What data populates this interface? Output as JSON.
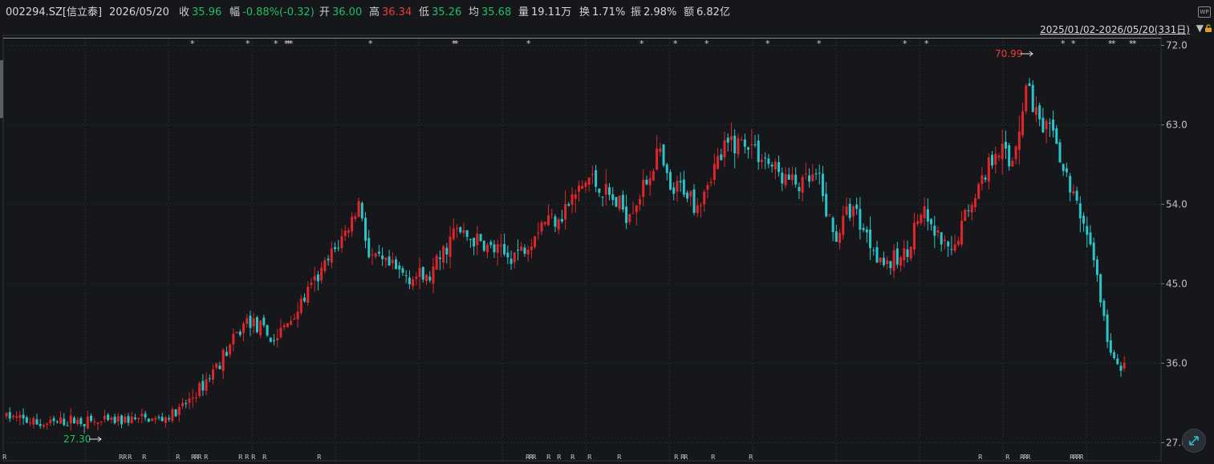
{
  "header": {
    "code": "002294.SZ[信立泰]",
    "date": "2026/05/20",
    "close_label": "收",
    "close": "35.96",
    "change_label": "幅",
    "change": "-0.88%(-0.32)",
    "open_label": "开",
    "open": "36.00",
    "high_label": "高",
    "high": "36.34",
    "low_label": "低",
    "low": "35.26",
    "avg_label": "均",
    "avg": "35.68",
    "volume_label": "量",
    "volume": "19.11万",
    "turnover_label": "换",
    "turnover": "1.71%",
    "amplitude_label": "振",
    "amplitude": "2.98%",
    "amount_label": "额",
    "amount": "6.82亿"
  },
  "range_label": "2025/01/02-2026/05/20(331日)",
  "wp_label": "WP",
  "colors": {
    "up": "#e0262b",
    "down": "#2bc5c9",
    "background": "#15171b",
    "grid": "#31353c"
  },
  "chart_data": {
    "type": "candlestick",
    "y_ticks": [
      "72.0",
      "63.0",
      "54.0",
      "45.0",
      "36.0",
      "27.0"
    ],
    "ylim": [
      26.0,
      72.0
    ],
    "count": 331,
    "max_label": "70.99",
    "min_label": "27.30",
    "anchors": [
      [
        0,
        30
      ],
      [
        20,
        29
      ],
      [
        40,
        29.5
      ],
      [
        55,
        29.2
      ],
      [
        70,
        29.6
      ],
      [
        90,
        29.6
      ],
      [
        100,
        30.5
      ],
      [
        112,
        33
      ],
      [
        130,
        38
      ],
      [
        140,
        41
      ],
      [
        155,
        38.5
      ],
      [
        165,
        41
      ],
      [
        175,
        44
      ],
      [
        185,
        47
      ],
      [
        200,
        52
      ],
      [
        205,
        54.5
      ],
      [
        210,
        48
      ],
      [
        220,
        47
      ],
      [
        230,
        46
      ],
      [
        245,
        45.5
      ],
      [
        260,
        51
      ],
      [
        270,
        50
      ],
      [
        280,
        49
      ],
      [
        290,
        48
      ],
      [
        300,
        49
      ],
      [
        310,
        52
      ],
      [
        322,
        53
      ],
      [
        338,
        57
      ],
      [
        348,
        55
      ],
      [
        360,
        53
      ],
      [
        370,
        56
      ],
      [
        378,
        60
      ],
      [
        385,
        55
      ],
      [
        392,
        56
      ],
      [
        400,
        54
      ],
      [
        410,
        58
      ],
      [
        420,
        61
      ],
      [
        430,
        61
      ],
      [
        440,
        59
      ],
      [
        450,
        57
      ],
      [
        460,
        56
      ],
      [
        470,
        57
      ],
      [
        480,
        50
      ],
      [
        490,
        54
      ],
      [
        500,
        50
      ],
      [
        510,
        47
      ],
      [
        520,
        48
      ],
      [
        530,
        53
      ],
      [
        540,
        50
      ],
      [
        548,
        48
      ],
      [
        556,
        53
      ],
      [
        566,
        57
      ],
      [
        575,
        61
      ],
      [
        582,
        58
      ],
      [
        592,
        68
      ],
      [
        600,
        62
      ],
      [
        608,
        62
      ],
      [
        612,
        58
      ],
      [
        620,
        54
      ],
      [
        628,
        50
      ],
      [
        632,
        46
      ],
      [
        636,
        41
      ],
      [
        640,
        37
      ],
      [
        644,
        35.5
      ],
      [
        648,
        36
      ]
    ],
    "star_positions": [
      240,
      309,
      344,
      357,
      360,
      363,
      462,
      566,
      569,
      659,
      800,
      842,
      881,
      957,
      1021,
      1128,
      1155,
      1325,
      1338,
      1384,
      1388,
      1410,
      1414
    ],
    "r_positions": [
      6,
      151,
      156,
      162,
      180,
      222,
      241,
      245,
      249,
      257,
      300,
      308,
      316,
      330,
      398,
      658,
      662,
      666,
      684,
      697,
      714,
      735,
      772,
      843,
      851,
      855,
      889,
      936,
      1222,
      1256,
      1274,
      1278,
      1282,
      1336,
      1340,
      1344,
      1348
    ],
    "star_label": "*",
    "r_label": "R"
  }
}
